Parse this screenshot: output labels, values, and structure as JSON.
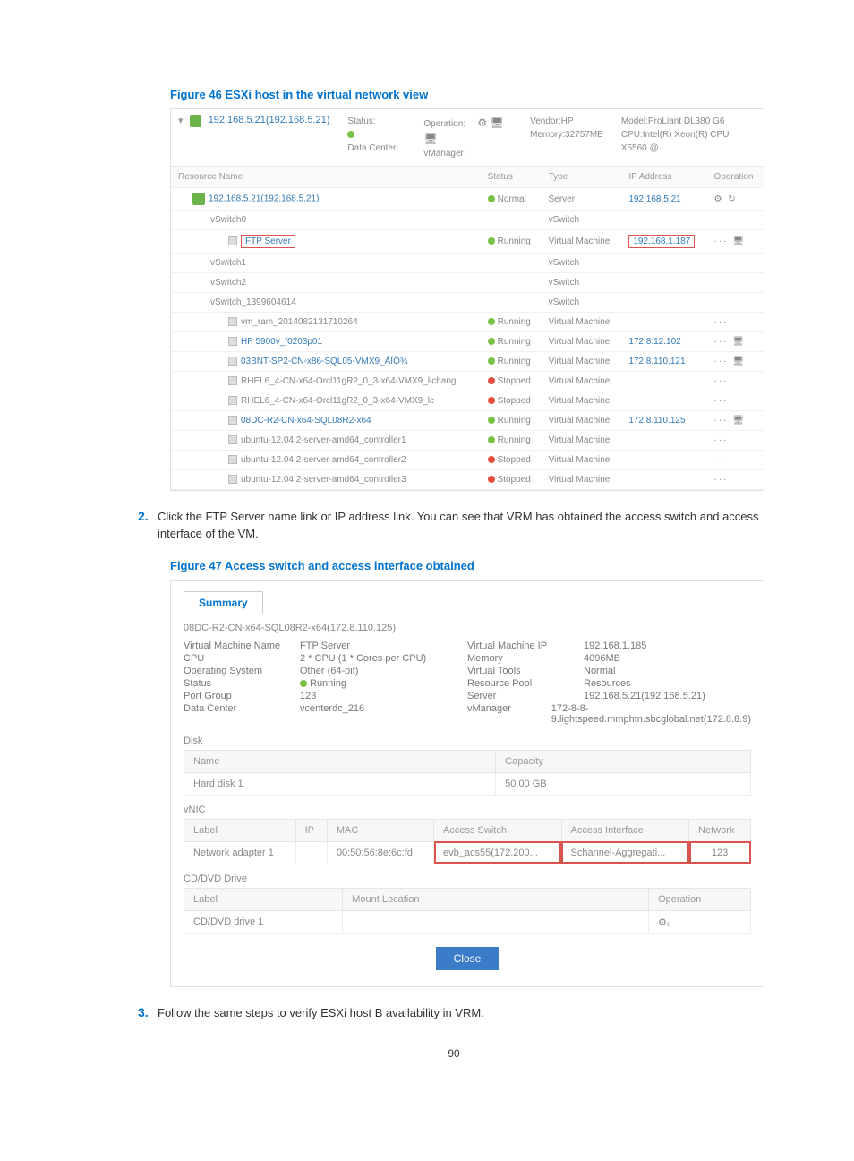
{
  "captions": {
    "fig46": "Figure 46 ESXi host in the virtual network view",
    "fig47": "Figure 47 Access switch and access interface obtained"
  },
  "steps": {
    "s2num": "2.",
    "s2txt": "Click the FTP Server name link or IP address link. You can see that VRM has obtained the access switch and access interface of the VM.",
    "s3num": "3.",
    "s3txt": "Follow the same steps to verify ESXi host B availability in VRM."
  },
  "fig46": {
    "host_link": "192.168.5.21(192.168.5.21)",
    "status_lab": "Status:",
    "datacenter_lab": "Data Center:",
    "operation_lab": "Operation:",
    "vmanager_lab": "vManager:",
    "vendor_lab": "Vendor:",
    "vendor_val": "HP",
    "memory_lab": "Memory:",
    "memory_val": "32757MB",
    "model_lab": "Model:",
    "model_val": "ProLiant DL380 G6",
    "cpu_lab": "CPU:",
    "cpu_val": "Intel(R) Xeon(R) CPU X5560 @",
    "headers": {
      "name": "Resource Name",
      "status": "Status",
      "type": "Type",
      "ip": "IP Address",
      "op": "Operation"
    },
    "rows": [
      {
        "name": "192.168.5.21(192.168.5.21)",
        "status": "Normal",
        "dot": "green",
        "type": "Server",
        "ip": "192.168.5.21",
        "link": true,
        "indent": 1,
        "op": "⚙ ↻"
      },
      {
        "name": "vSwitch0",
        "status": "",
        "dot": "",
        "type": "vSwitch",
        "ip": "",
        "indent": 2
      },
      {
        "name": "FTP Server",
        "status": "Running",
        "dot": "green",
        "type": "Virtual Machine",
        "ip": "192.168.1.187",
        "redbox_name": true,
        "redbox_ip": true,
        "indent": 3,
        "op": "··· 🖥"
      },
      {
        "name": "vSwitch1",
        "status": "",
        "dot": "",
        "type": "vSwitch",
        "ip": "",
        "indent": 2
      },
      {
        "name": "vSwitch2",
        "status": "",
        "dot": "",
        "type": "vSwitch",
        "ip": "",
        "indent": 2
      },
      {
        "name": "vSwitch_1399604614",
        "status": "",
        "dot": "",
        "type": "vSwitch",
        "ip": "",
        "indent": 2
      },
      {
        "name": "vm_ram_2014082131710264",
        "status": "Running",
        "dot": "green",
        "type": "Virtual Machine",
        "ip": "",
        "indent": 3,
        "op": "···"
      },
      {
        "name": "HP 5900v_f0203p01",
        "status": "Running",
        "dot": "green",
        "type": "Virtual Machine",
        "ip": "172.8.12.102",
        "link": true,
        "indent": 3,
        "op": "··· 🖥"
      },
      {
        "name": "03BNT-SP2-CN-x86-SQL05-VMX9_ÁÍÖ¾",
        "status": "Running",
        "dot": "green",
        "type": "Virtual Machine",
        "ip": "172.8.110.121",
        "link": true,
        "indent": 3,
        "op": "··· 🖥"
      },
      {
        "name": "RHEL6_4-CN-x64-Orcl11gR2_0_3-x64-VMX9_lichang",
        "status": "Stopped",
        "dot": "red",
        "type": "Virtual Machine",
        "ip": "",
        "indent": 3,
        "op": "···"
      },
      {
        "name": "RHEL6_4-CN-x64-Orcl11gR2_0_3-x64-VMX9_lc",
        "status": "Stopped",
        "dot": "red",
        "type": "Virtual Machine",
        "ip": "",
        "indent": 3,
        "op": "···"
      },
      {
        "name": "08DC-R2-CN-x64-SQL08R2-x64",
        "status": "Running",
        "dot": "green",
        "type": "Virtual Machine",
        "ip": "172.8.110.125",
        "link": true,
        "indent": 3,
        "op": "··· 🖥"
      },
      {
        "name": "ubuntu-12.04.2-server-amd64_controller1",
        "status": "Running",
        "dot": "green",
        "type": "Virtual Machine",
        "ip": "",
        "indent": 3,
        "op": "···"
      },
      {
        "name": "ubuntu-12.04.2-server-amd64_controller2",
        "status": "Stopped",
        "dot": "red",
        "type": "Virtual Machine",
        "ip": "",
        "indent": 3,
        "op": "···"
      },
      {
        "name": "ubuntu-12.04.2-server-amd64_controller3",
        "status": "Stopped",
        "dot": "red",
        "type": "Virtual Machine",
        "ip": "",
        "indent": 3,
        "op": "···"
      }
    ]
  },
  "fig47": {
    "tab": "Summary",
    "sub": "08DC-R2-CN-x64-SQL08R2-x64(172.8.110.125)",
    "left": [
      {
        "k": "Virtual Machine Name",
        "v": "FTP Server"
      },
      {
        "k": "CPU",
        "v": "2 * CPU  (1 * Cores per CPU)"
      },
      {
        "k": "Operating System",
        "v": "Other (64-bit)"
      },
      {
        "k": "Status",
        "v": "Running",
        "dot": true
      },
      {
        "k": "Port Group",
        "v": "123"
      },
      {
        "k": "Data Center",
        "v": "vcenterdc_216"
      }
    ],
    "right": [
      {
        "k": "Virtual Machine IP",
        "v": "192.168.1.185"
      },
      {
        "k": "Memory",
        "v": "4096MB"
      },
      {
        "k": "Virtual Tools",
        "v": "Normal"
      },
      {
        "k": "Resource Pool",
        "v": "Resources"
      },
      {
        "k": "Server",
        "v": "192.168.5.21(192.168.5.21)"
      },
      {
        "k": "vManager",
        "v": "172-8-8-9.lightspeed.mmphtn.sbcglobal.net(172.8.8.9)"
      }
    ],
    "disk_title": "Disk",
    "disk_headers": {
      "name": "Name",
      "cap": "Capacity"
    },
    "disk_row": {
      "name": "Hard disk 1",
      "cap": "50.00 GB"
    },
    "vnic_title": "vNIC",
    "vnic_headers": {
      "label": "Label",
      "ip": "IP",
      "mac": "MAC",
      "sw": "Access Switch",
      "intf": "Access Interface",
      "net": "Network"
    },
    "vnic_row": {
      "label": "Network adapter 1",
      "ip": "",
      "mac": "00:50:56:8e:6c:fd",
      "sw": "evb_acs55(172.200...",
      "intf": "Schannel-Aggregati...",
      "net": "123"
    },
    "cd_title": "CD/DVD Drive",
    "cd_headers": {
      "label": "Label",
      "mount": "Mount Location",
      "op": "Operation"
    },
    "cd_row": {
      "label": "CD/DVD drive 1",
      "mount": "",
      "op": "⚙₀"
    },
    "close": "Close"
  },
  "pagenum": "90"
}
